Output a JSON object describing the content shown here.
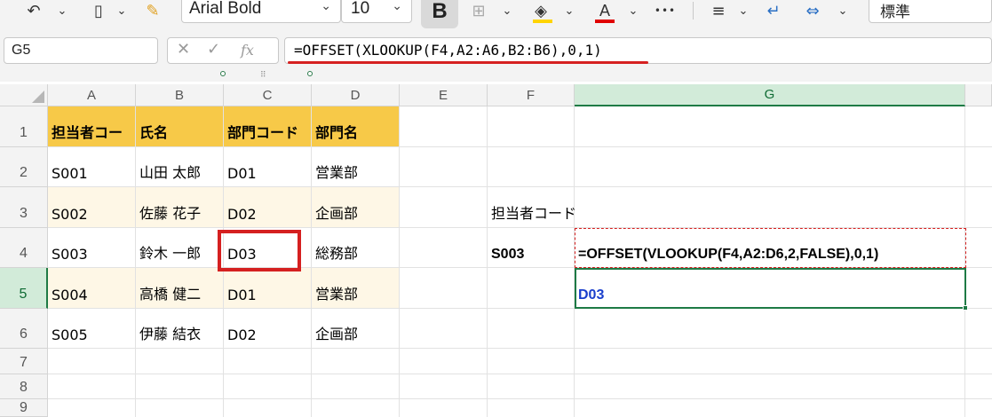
{
  "toolbar": {
    "undo_icon": "undo-icon",
    "font_name": "Arial Bold",
    "font_size": "10",
    "bold_label": "B",
    "font_color_letter": "A",
    "more_label": "•••",
    "number_format": "標準",
    "fill_color": "#ffd400",
    "font_color": "#e00000"
  },
  "formula_bar": {
    "name_box": "G5",
    "cancel_glyph": "✕",
    "confirm_glyph": "✓",
    "fx_glyph": "fx",
    "formula": "=OFFSET(XLOOKUP(F4,A2:A6,B2:B6),0,1)"
  },
  "grid": {
    "columns": [
      "A",
      "B",
      "C",
      "D",
      "E",
      "F",
      "G"
    ],
    "rows": [
      "1",
      "2",
      "3",
      "4",
      "5",
      "6",
      "7",
      "8",
      "9"
    ],
    "active_column": "G",
    "active_row": "5",
    "header_fill": "#f7c948",
    "band_fill": "#fef7e6",
    "table": {
      "headers": [
        "担当者コー",
        "氏名",
        "部門コード",
        "部門名"
      ],
      "rows": [
        [
          "S001",
          "山田 太郎",
          "D01",
          "営業部"
        ],
        [
          "S002",
          "佐藤 花子",
          "D02",
          "企画部"
        ],
        [
          "S003",
          "鈴木 一郎",
          "D03",
          "総務部"
        ],
        [
          "S004",
          "高橋 健二",
          "D01",
          "営業部"
        ],
        [
          "S005",
          "伊藤 結衣",
          "D02",
          "企画部"
        ]
      ]
    },
    "lookup": {
      "label": "担当者コード",
      "key": "S003",
      "formula_text": "=OFFSET(VLOOKUP(F4,A2:D6,2,FALSE),0,1)",
      "result": "D03",
      "result_color": "#1a3fcc"
    }
  }
}
